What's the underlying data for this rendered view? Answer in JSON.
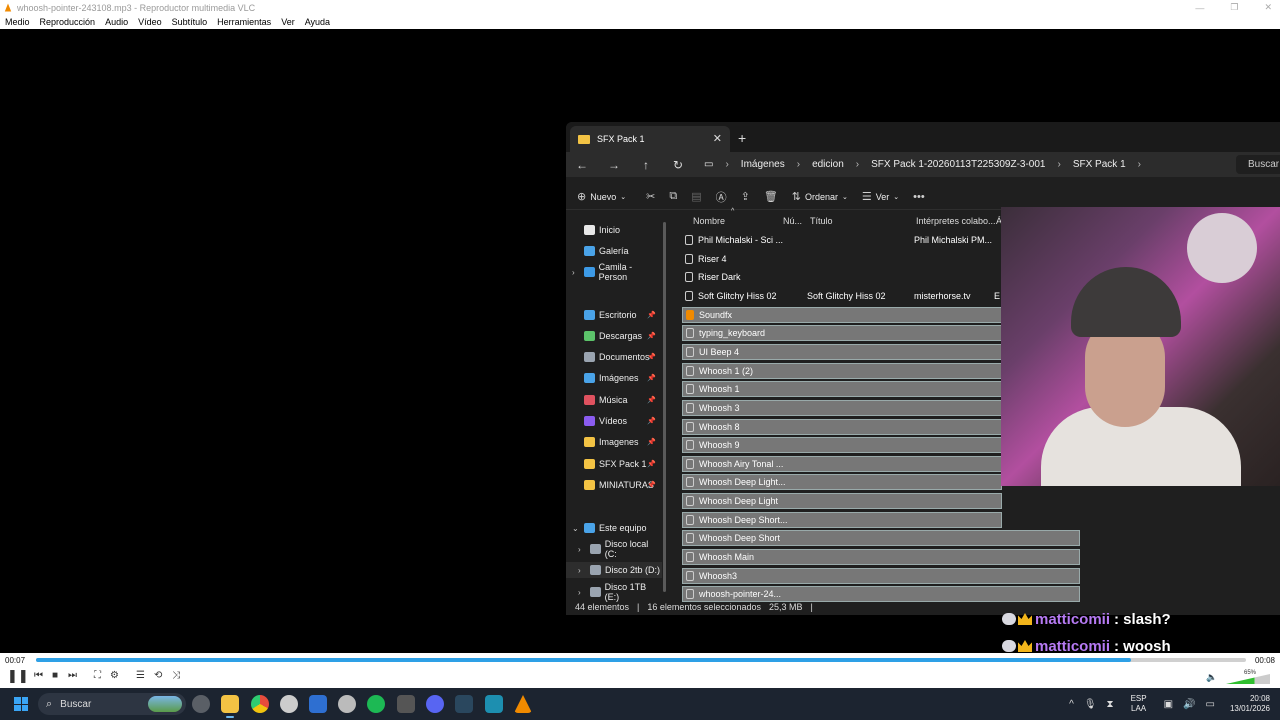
{
  "vlc": {
    "title": "whoosh-pointer-243108.mp3 - Reproductor multimedia VLC",
    "menu": [
      "Medio",
      "Reproducción",
      "Audio",
      "Vídeo",
      "Subtítulo",
      "Herramientas",
      "Ver",
      "Ayuda"
    ],
    "time_current": "00:07",
    "time_total": "00:08",
    "progress": 0.905,
    "volume_label": "65%",
    "volume": 0.65
  },
  "explorer": {
    "tab_title": "SFX Pack 1",
    "breadcrumb": [
      "Imágenes",
      "edicion",
      "SFX Pack 1-20260113T225309Z-3-001",
      "SFX Pack 1"
    ],
    "search_placeholder": "Buscar e",
    "toolbar": {
      "new": "Nuevo",
      "sort": "Ordenar",
      "view": "Ver"
    },
    "sidebar": [
      {
        "label": "Inicio",
        "icon": "home-icon",
        "color": "#e8e8e8",
        "pinned": false
      },
      {
        "label": "Galería",
        "icon": "gallery-icon",
        "color": "#4aa3e8",
        "pinned": false
      },
      {
        "label": "Camila - Person",
        "icon": "onedrive-icon",
        "color": "#3d9ae6",
        "pinned": false
      },
      {
        "label": "Escritorio",
        "icon": "desktop-icon",
        "color": "#4aa3e8",
        "pinned": true
      },
      {
        "label": "Descargas",
        "icon": "download-icon",
        "color": "#5cc36a",
        "pinned": true
      },
      {
        "label": "Documentos",
        "icon": "documents-icon",
        "color": "#9aa4b0",
        "pinned": true
      },
      {
        "label": "Imágenes",
        "icon": "pictures-icon",
        "color": "#4aa3e8",
        "pinned": true
      },
      {
        "label": "Música",
        "icon": "music-icon",
        "color": "#e0525f",
        "pinned": true
      },
      {
        "label": "Vídeos",
        "icon": "videos-icon",
        "color": "#8b5cf0",
        "pinned": true
      },
      {
        "label": "Imagenes",
        "icon": "folder-icon",
        "color": "#f3c344",
        "pinned": true
      },
      {
        "label": "SFX Pack 1",
        "icon": "folder-icon",
        "color": "#f3c344",
        "pinned": true
      },
      {
        "label": "MINIATURAS",
        "icon": "folder-icon",
        "color": "#f3c344",
        "pinned": true
      },
      {
        "label": "Este equipo",
        "icon": "computer-icon",
        "color": "#4aa3e8",
        "pinned": false
      },
      {
        "label": "Disco local (C:",
        "icon": "drive-icon",
        "color": "#9aa4b0",
        "pinned": false
      },
      {
        "label": "Disco 2tb (D:)",
        "icon": "drive-icon",
        "color": "#9aa4b0",
        "pinned": false
      },
      {
        "label": "Disco 1TB (E:)",
        "icon": "drive-icon",
        "color": "#9aa4b0",
        "pinned": false
      }
    ],
    "columns": [
      "Nombre",
      "Nú...",
      "Título",
      "Intérpretes colabo...",
      "Á"
    ],
    "rows": [
      {
        "name": "Phil Michalski - Sci ...",
        "title": "",
        "artist": "Phil Michalski PM...",
        "extra": "",
        "selected": false
      },
      {
        "name": "Riser 4",
        "title": "",
        "artist": "",
        "extra": "",
        "selected": false
      },
      {
        "name": "Riser Dark",
        "title": "",
        "artist": "",
        "extra": "",
        "selected": false
      },
      {
        "name": "Soft Glitchy Hiss 02",
        "title": "Soft Glitchy Hiss 02",
        "artist": "misterhorse.tv",
        "extra": "E",
        "selected": false
      },
      {
        "name": "Soundfx",
        "title": "",
        "artist": "",
        "extra": "",
        "selected": true
      },
      {
        "name": "typing_keyboard",
        "title": "",
        "artist": "",
        "extra": "",
        "selected": true
      },
      {
        "name": "UI Beep 4",
        "title": "",
        "artist": "",
        "extra": "",
        "selected": true
      },
      {
        "name": "Whoosh 1 (2)",
        "title": "",
        "artist": "",
        "extra": "",
        "selected": true
      },
      {
        "name": "Whoosh 1",
        "title": "",
        "artist": "",
        "extra": "",
        "selected": true
      },
      {
        "name": "Whoosh 3",
        "title": "",
        "artist": "",
        "extra": "",
        "selected": true
      },
      {
        "name": "Whoosh 8",
        "title": "",
        "artist": "",
        "extra": "",
        "selected": true
      },
      {
        "name": "Whoosh 9",
        "title": "",
        "artist": "",
        "extra": "",
        "selected": true
      },
      {
        "name": "Whoosh Airy Tonal ...",
        "title": "",
        "artist": "",
        "extra": "",
        "selected": true
      },
      {
        "name": "Whoosh Deep Light...",
        "title": "",
        "artist": "",
        "extra": "",
        "selected": true
      },
      {
        "name": "Whoosh Deep Light",
        "title": "",
        "artist": "",
        "extra": "",
        "selected": true
      },
      {
        "name": "Whoosh Deep Short...",
        "title": "",
        "artist": "",
        "extra": "",
        "selected": true
      },
      {
        "name": "Whoosh Deep Short",
        "title": "",
        "artist": "",
        "extra": "",
        "selected": true
      },
      {
        "name": "Whoosh Main",
        "title": "",
        "artist": "",
        "extra": "",
        "selected": true
      },
      {
        "name": "Whoosh3",
        "title": "",
        "artist": "",
        "extra": "",
        "selected": true
      },
      {
        "name": "whoosh-pointer-24...",
        "title": "",
        "artist": "",
        "extra": "",
        "selected": true
      }
    ],
    "status": {
      "count": "44 elementos",
      "selected": "16 elementos seleccionados",
      "size": "25,3 MB"
    }
  },
  "chat": [
    {
      "user": "matticomii",
      "message": ": slash?"
    },
    {
      "user": "matticomii",
      "message": ": woosh"
    }
  ],
  "taskbar": {
    "search": "Buscar",
    "lang1": "ESP",
    "lang2": "LAA",
    "time": "20:08",
    "date": "13/01/2026"
  }
}
